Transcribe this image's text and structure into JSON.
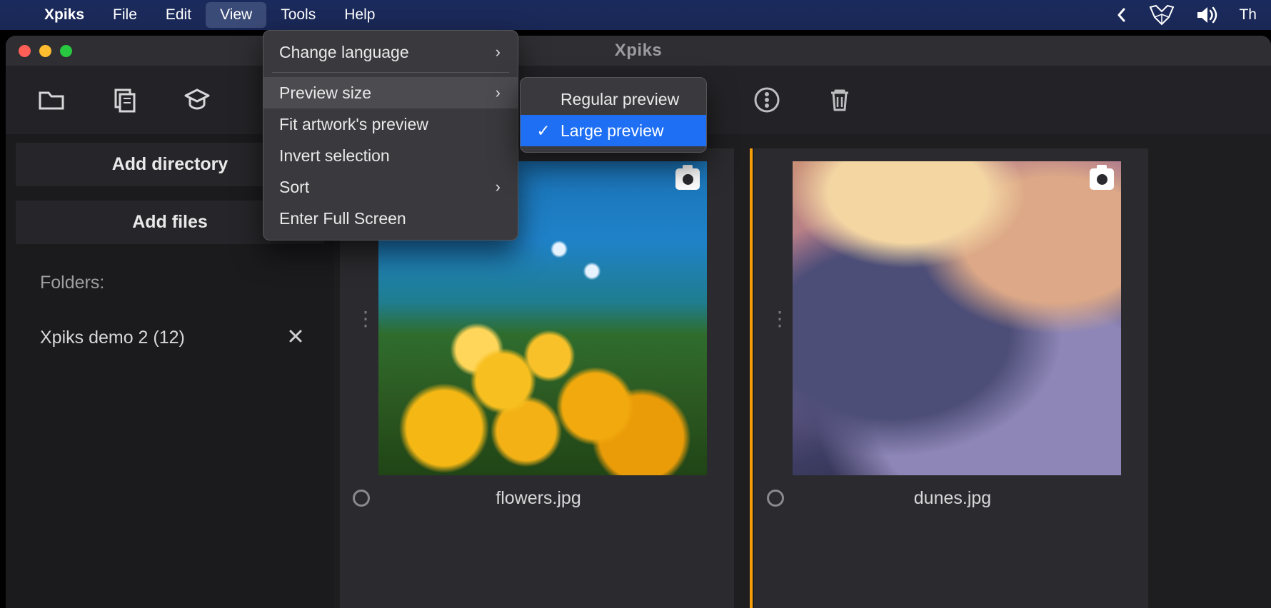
{
  "menubar": {
    "app_name": "Xpiks",
    "items": [
      "File",
      "Edit",
      "View",
      "Tools",
      "Help"
    ],
    "active_index": 2,
    "status_right_text": "Th"
  },
  "window": {
    "title": "Xpiks"
  },
  "sidebar": {
    "add_directory_label": "Add directory",
    "add_files_label": "Add files",
    "folders_label": "Folders:",
    "folders": [
      {
        "name": "Xpiks demo 2 (12)"
      }
    ]
  },
  "gallery": {
    "items": [
      {
        "filename": "flowers.jpg",
        "art": "art-flowers",
        "selected": false
      },
      {
        "filename": "dunes.jpg",
        "art": "art-dunes",
        "selected": true
      }
    ]
  },
  "view_menu": {
    "items": [
      {
        "label": "Change language",
        "has_submenu": true
      },
      {
        "divider": true
      },
      {
        "label": "Preview size",
        "has_submenu": true,
        "highlighted": true
      },
      {
        "label": "Fit artwork's preview"
      },
      {
        "label": "Invert selection"
      },
      {
        "label": "Sort",
        "has_submenu": true
      },
      {
        "label": "Enter Full Screen"
      }
    ]
  },
  "preview_submenu": {
    "items": [
      {
        "label": "Regular preview",
        "checked": false,
        "selected": false
      },
      {
        "label": "Large preview",
        "checked": true,
        "selected": true
      }
    ]
  }
}
